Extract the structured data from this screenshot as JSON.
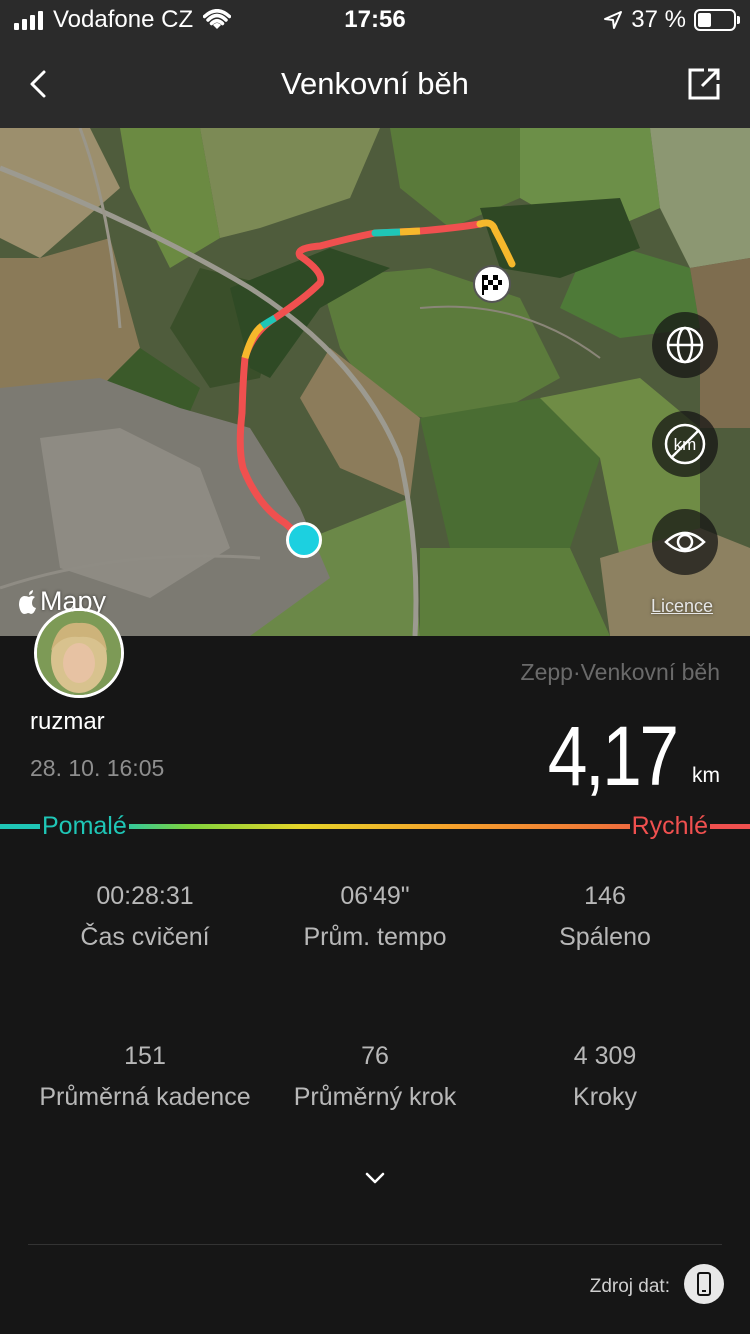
{
  "status_bar": {
    "carrier": "Vodafone CZ",
    "time": "17:56",
    "battery": "37 %",
    "battery_level": 0.37
  },
  "nav": {
    "title": "Venkovní běh"
  },
  "map": {
    "attribution": "Mapy",
    "licence_link": "Licence"
  },
  "workout": {
    "source_app": "Zepp·Venkovní běh",
    "username": "ruzmar",
    "datetime": "28. 10. 16:05",
    "distance": "4,17",
    "distance_unit": "km"
  },
  "pace_legend": {
    "slow": "Pomalé",
    "fast": "Rychlé",
    "slow_color": "#1fc6b6",
    "fast_color": "#f0504f"
  },
  "stats": [
    {
      "value": "00:28:31",
      "label": "Čas cvičení"
    },
    {
      "value": "06'49\"",
      "label": "Prům. tempo"
    },
    {
      "value": "146",
      "label": "Spáleno"
    },
    {
      "value": "151",
      "label": "Průměrná kadence"
    },
    {
      "value": "76",
      "label": "Průměrný krok"
    },
    {
      "value": "4 309",
      "label": "Kroky"
    }
  ],
  "footer": {
    "data_source_label": "Zdroj dat:"
  }
}
